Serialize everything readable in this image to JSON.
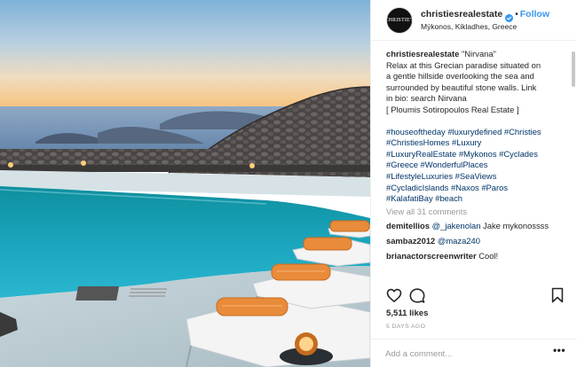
{
  "post": {
    "username": "christiesrealestate",
    "verified": true,
    "dot": "•",
    "follow_label": "Follow",
    "location": "Mýkonos, Kikladhes, Greece",
    "avatar_mark": "CHRISTIE'S",
    "caption": {
      "username": "christiesrealestate",
      "title": "\"Nirvana\"",
      "lines": [
        "Relax at this Grecian paradise situated on",
        "a gentle hillside overlooking the sea and",
        "surrounded by beautiful stone walls. Link",
        "in bio: search Nirvana",
        "[ Ploumis Sotiropoulos Real Estate ]"
      ],
      "hashtag_lines": [
        "#houseoftheday #luxurydefined #Christies",
        "#ChristiesHomes #Luxury",
        "#LuxuryRealEstate #Mykonos #Cyclades",
        "#Greece #WonderfulPlaces",
        "#LifestyleLuxuries #SeaViews",
        "#CycladicIslands #Naxos #Paros",
        "#KalafatiBay #beach"
      ]
    },
    "view_all_comments": "View all 31 comments",
    "comments": [
      {
        "user": "demitellios",
        "mention": "@_jakenolan",
        "text": " Jake mykonossss"
      },
      {
        "user": "sambaz2012",
        "mention": "@maza240",
        "text": ""
      },
      {
        "user": "brianactorscreenwriter",
        "mention": "",
        "text": "Cool!"
      }
    ],
    "likes": "5,511 likes",
    "time_ago": "5 DAYS AGO",
    "add_comment_placeholder": "Add a comment...",
    "more_label": "•••",
    "icons": {
      "like": "heart-icon",
      "comment": "speech-bubble-icon",
      "save": "bookmark-icon",
      "verified": "verified-badge-icon",
      "more": "more-options-icon"
    }
  },
  "colors": {
    "link_blue": "#3897f0",
    "hashtag_blue": "#003569",
    "text": "#262626",
    "muted": "#999999",
    "divider": "#efefef"
  }
}
